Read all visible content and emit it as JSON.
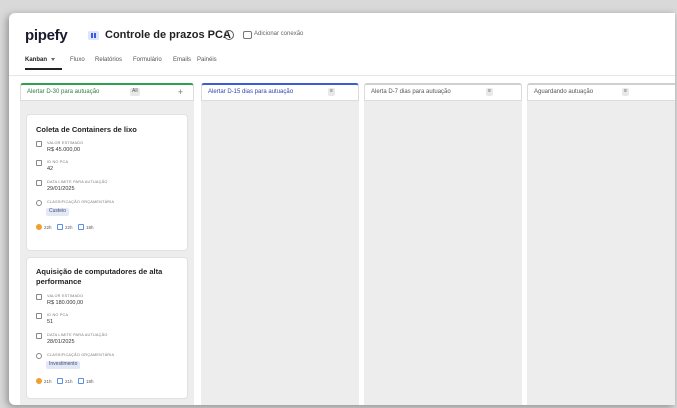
{
  "app": {
    "logo": "pipefy",
    "pipe_title": "Controle de prazos PCA",
    "add_connection": "Adicionar conexão"
  },
  "nav": {
    "kanban": "Kanban",
    "fluxo": "Fluxo",
    "relatorios": "Relatórios",
    "formulario": "Formulário",
    "emails": "Emails",
    "paineis": "Painéis"
  },
  "columns": [
    {
      "title": "Alertar D-30 para autuação",
      "badge": "All",
      "accent": "#2e9e4f"
    },
    {
      "title": "Alertar D-15 dias para autuação",
      "badge": "",
      "accent": "#3b5bdb"
    },
    {
      "title": "Alerta D-7 dias para autuação",
      "badge": "",
      "accent": "#cfcfcf"
    },
    {
      "title": "Aguardando autuação",
      "badge": "",
      "accent": "#cfcfcf"
    }
  ],
  "cards": [
    {
      "title": "Coleta de Containers de lixo",
      "valor_label": "VALOR ESTIMADO",
      "valor": "R$ 45.000,00",
      "id_label": "ID NO PCA",
      "id": "42",
      "data_label": "DATA LIMITE PARA AUTUAÇÃO",
      "data": "29/01/2025",
      "class_label": "CLASSIFICAÇÃO ORÇAMENTÁRIA",
      "class": "Custeio",
      "stats": [
        "22h",
        "22h",
        "18h"
      ]
    },
    {
      "title": "Aquisição de computadores de alta performance",
      "valor_label": "VALOR ESTIMADO",
      "valor": "R$ 180.000,00",
      "id_label": "ID NO PCA",
      "id": "51",
      "data_label": "DATA LIMITE PARA AUTUAÇÃO",
      "data": "28/01/2025",
      "class_label": "CLASSIFICAÇÃO ORÇAMENTÁRIA",
      "class": "Investimento",
      "stats": [
        "21h",
        "21h",
        "18h"
      ]
    }
  ],
  "colors": {
    "accent_green": "#2e9e4f",
    "accent_blue": "#3b5bdb",
    "stat_orange": "#f0a030",
    "stat_blue": "#5b8def"
  }
}
